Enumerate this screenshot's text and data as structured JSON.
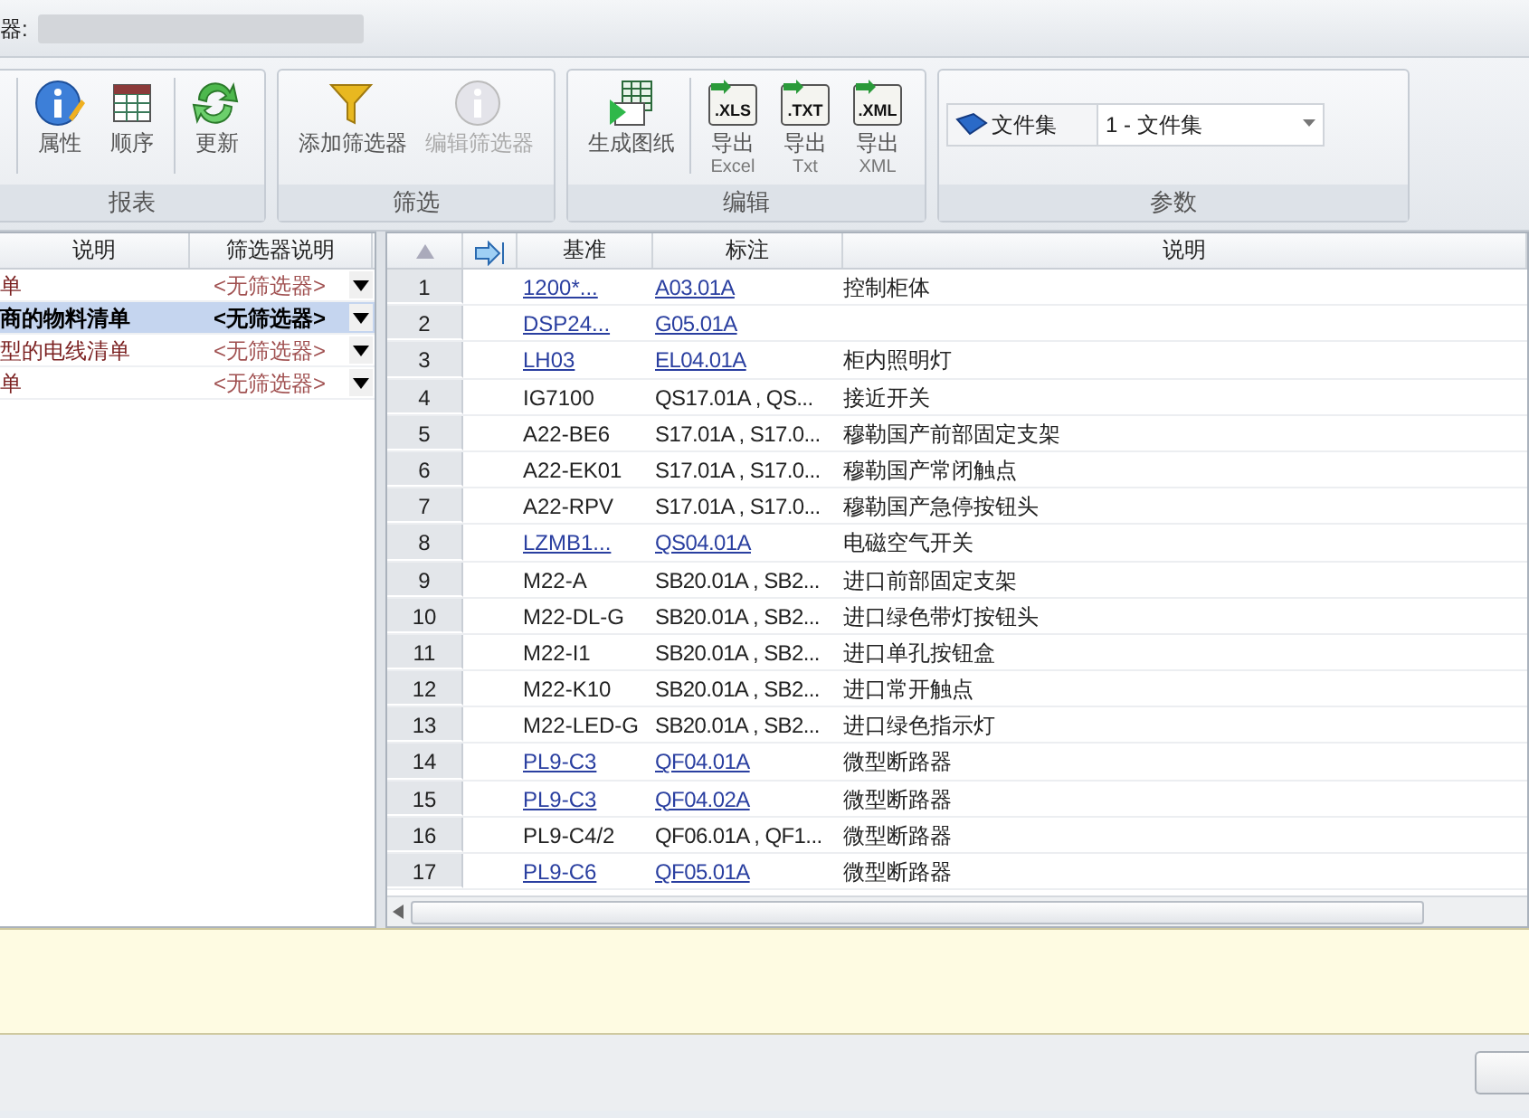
{
  "top_bar": {
    "label": "器:"
  },
  "ribbon": {
    "groups": [
      {
        "title": "报表",
        "buttons": [
          {
            "label": "属性",
            "kind": "info",
            "disabled": false
          },
          {
            "label": "顺序",
            "kind": "grid",
            "disabled": false
          },
          {
            "label": "更新",
            "kind": "refresh",
            "disabled": false
          }
        ]
      },
      {
        "title": "筛选",
        "buttons": [
          {
            "label": "添加筛选器",
            "kind": "funnel",
            "disabled": false
          },
          {
            "label": "编辑筛选器",
            "kind": "info",
            "disabled": true
          }
        ]
      },
      {
        "title": "编辑",
        "buttons": [
          {
            "label": "生成图纸",
            "kind": "sheet",
            "disabled": false
          },
          {
            "label": "导出",
            "sublabel": "Excel",
            "badge": ".XLS",
            "kind": "export",
            "disabled": false
          },
          {
            "label": "导出",
            "sublabel": "Txt",
            "badge": ".TXT",
            "kind": "export",
            "disabled": false
          },
          {
            "label": "导出",
            "sublabel": "XML",
            "badge": ".XML",
            "kind": "export",
            "disabled": false
          }
        ]
      },
      {
        "title": "参数",
        "field_label": "文件集",
        "field_value": "1 - 文件集"
      }
    ]
  },
  "report_list": {
    "columns": [
      "说明",
      "筛选器说明"
    ],
    "rows": [
      {
        "description": "单",
        "filter": "<无筛选器>",
        "selected": false
      },
      {
        "description": "商的物料清单",
        "filter": "<无筛选器>",
        "selected": true
      },
      {
        "description": "型的电线清单",
        "filter": "<无筛选器>",
        "selected": false
      },
      {
        "description": "单",
        "filter": "<无筛选器>",
        "selected": false
      }
    ]
  },
  "grid": {
    "columns": [
      "基准",
      "标注",
      "说明"
    ],
    "rows": [
      {
        "number": "1",
        "base": {
          "text": "1200*...",
          "link": true
        },
        "mark": {
          "text": "A03.01A",
          "link": true
        },
        "description": "控制柜体"
      },
      {
        "number": "2",
        "base": {
          "text": "DSP24...",
          "link": true
        },
        "mark": {
          "text": "G05.01A",
          "link": true
        }
      },
      {
        "number": "3",
        "base": {
          "text": "LH03",
          "link": true
        },
        "mark": {
          "text": "EL04.01A",
          "link": true
        },
        "description": "柜内照明灯"
      },
      {
        "number": "4",
        "base": {
          "text": "IG7100",
          "link": false
        },
        "mark": {
          "text": "QS17.01A , QS...",
          "link": false
        },
        "description": "接近开关"
      },
      {
        "number": "5",
        "base": {
          "text": "A22-BE6",
          "link": false
        },
        "mark": {
          "text": "S17.01A , S17.0...",
          "link": false
        },
        "description": "穆勒国产前部固定支架"
      },
      {
        "number": "6",
        "base": {
          "text": "A22-EK01",
          "link": false
        },
        "mark": {
          "text": "S17.01A , S17.0...",
          "link": false
        },
        "description": "穆勒国产常闭触点"
      },
      {
        "number": "7",
        "base": {
          "text": "A22-RPV",
          "link": false
        },
        "mark": {
          "text": "S17.01A , S17.0...",
          "link": false
        },
        "description": "穆勒国产急停按钮头"
      },
      {
        "number": "8",
        "base": {
          "text": "LZMB1...",
          "link": true
        },
        "mark": {
          "text": "QS04.01A",
          "link": true
        },
        "description": "电磁空气开关"
      },
      {
        "number": "9",
        "base": {
          "text": "M22-A",
          "link": false
        },
        "mark": {
          "text": "SB20.01A , SB2...",
          "link": false
        },
        "description": "进口前部固定支架"
      },
      {
        "number": "10",
        "base": {
          "text": "M22-DL-G",
          "link": false
        },
        "mark": {
          "text": "SB20.01A , SB2...",
          "link": false
        },
        "description": "进口绿色带灯按钮头"
      },
      {
        "number": "11",
        "base": {
          "text": "M22-I1",
          "link": false
        },
        "mark": {
          "text": "SB20.01A , SB2...",
          "link": false
        },
        "description": "进口单孔按钮盒"
      },
      {
        "number": "12",
        "base": {
          "text": "M22-K10",
          "link": false
        },
        "mark": {
          "text": "SB20.01A , SB2...",
          "link": false
        },
        "description": "进口常开触点"
      },
      {
        "number": "13",
        "base": {
          "text": "M22-LED-G",
          "link": false
        },
        "mark": {
          "text": "SB20.01A , SB2...",
          "link": false
        },
        "description": "进口绿色指示灯"
      },
      {
        "number": "14",
        "base": {
          "text": "PL9-C3",
          "link": true
        },
        "mark": {
          "text": "QF04.01A",
          "link": true
        },
        "description": "微型断路器"
      },
      {
        "number": "15",
        "base": {
          "text": "PL9-C3",
          "link": true
        },
        "mark": {
          "text": "QF04.02A",
          "link": true
        },
        "description": "微型断路器"
      },
      {
        "number": "16",
        "base": {
          "text": "PL9-C4/2",
          "link": false
        },
        "mark": {
          "text": "QF06.01A , QF1...",
          "link": false
        },
        "description": "微型断路器"
      },
      {
        "number": "17",
        "base": {
          "text": "PL9-C6",
          "link": true
        },
        "mark": {
          "text": "QF05.01A",
          "link": true
        },
        "description": "微型断路器"
      }
    ]
  }
}
